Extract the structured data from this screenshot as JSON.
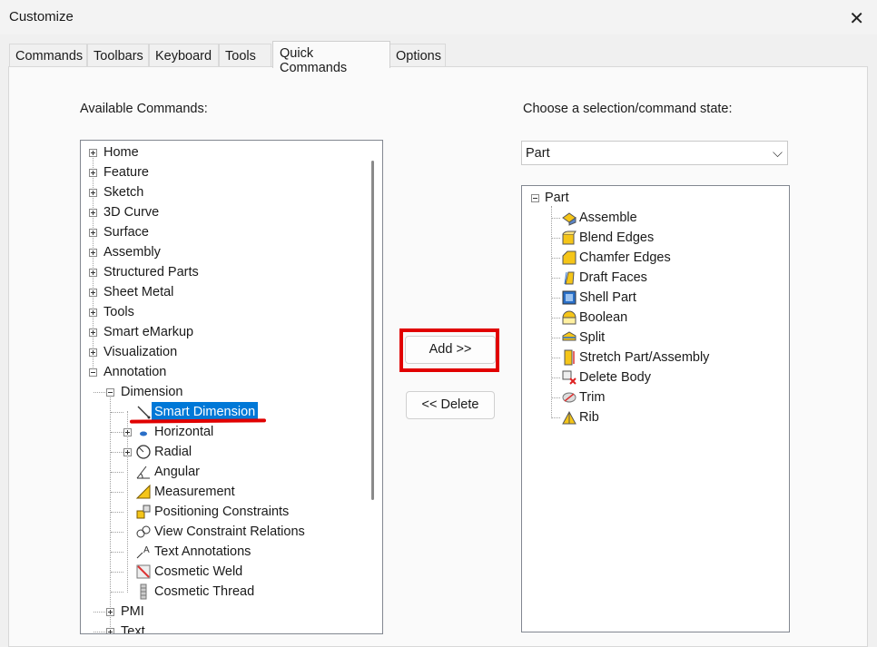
{
  "window": {
    "title": "Customize",
    "close_glyph": "✕"
  },
  "tabs": [
    {
      "label": "Commands",
      "active": false
    },
    {
      "label": "Toolbars",
      "active": false
    },
    {
      "label": "Keyboard",
      "active": false
    },
    {
      "label": "Tools",
      "active": false
    },
    {
      "label": "Quick Commands",
      "active": true
    },
    {
      "label": "Options",
      "active": false
    }
  ],
  "left": {
    "label": "Available Commands:",
    "tree": [
      {
        "label": "Home",
        "level": 0,
        "expander": "plus"
      },
      {
        "label": "Feature",
        "level": 0,
        "expander": "plus"
      },
      {
        "label": "Sketch",
        "level": 0,
        "expander": "plus"
      },
      {
        "label": "3D Curve",
        "level": 0,
        "expander": "plus"
      },
      {
        "label": "Surface",
        "level": 0,
        "expander": "plus"
      },
      {
        "label": "Assembly",
        "level": 0,
        "expander": "plus"
      },
      {
        "label": "Structured Parts",
        "level": 0,
        "expander": "plus"
      },
      {
        "label": "Sheet Metal",
        "level": 0,
        "expander": "plus"
      },
      {
        "label": "Tools",
        "level": 0,
        "expander": "plus"
      },
      {
        "label": "Smart eMarkup",
        "level": 0,
        "expander": "plus"
      },
      {
        "label": "Visualization",
        "level": 0,
        "expander": "plus"
      },
      {
        "label": "Annotation",
        "level": 0,
        "expander": "minus"
      },
      {
        "label": "Dimension",
        "level": 1,
        "expander": "minus"
      },
      {
        "label": "Smart Dimension",
        "level": 2,
        "icon": "smart-dimension-icon",
        "selected": true
      },
      {
        "label": "Horizontal",
        "level": 2,
        "expander": "plus",
        "icon": "horizontal-dimension-icon"
      },
      {
        "label": "Radial",
        "level": 2,
        "expander": "plus",
        "icon": "radial-dimension-icon"
      },
      {
        "label": "Angular",
        "level": 2,
        "icon": "angular-dimension-icon"
      },
      {
        "label": "Measurement",
        "level": 2,
        "icon": "measurement-icon"
      },
      {
        "label": "Positioning Constraints",
        "level": 2,
        "icon": "positioning-constraints-icon"
      },
      {
        "label": "View Constraint Relations",
        "level": 2,
        "icon": "view-constraint-relations-icon"
      },
      {
        "label": "Text Annotations",
        "level": 2,
        "icon": "text-annotations-icon"
      },
      {
        "label": "Cosmetic Weld",
        "level": 2,
        "icon": "cosmetic-weld-icon"
      },
      {
        "label": "Cosmetic Thread",
        "level": 2,
        "icon": "cosmetic-thread-icon"
      },
      {
        "label": "PMI",
        "level": 1,
        "expander": "plus"
      },
      {
        "label": "Text",
        "level": 1,
        "expander": "plus"
      }
    ]
  },
  "middle": {
    "add_label": "Add >>",
    "delete_label": "<< Delete"
  },
  "right": {
    "label": "Choose a selection/command state:",
    "combo_value": "Part",
    "combo_chevron": "⌵",
    "tree_root": "Part",
    "tree": [
      {
        "label": "Assemble",
        "icon": "assemble-icon"
      },
      {
        "label": "Blend Edges",
        "icon": "blend-edges-icon"
      },
      {
        "label": "Chamfer Edges",
        "icon": "chamfer-edges-icon"
      },
      {
        "label": "Draft Faces",
        "icon": "draft-faces-icon"
      },
      {
        "label": "Shell Part",
        "icon": "shell-part-icon"
      },
      {
        "label": "Boolean",
        "icon": "boolean-icon"
      },
      {
        "label": "Split",
        "icon": "split-icon"
      },
      {
        "label": "Stretch Part/Assembly",
        "icon": "stretch-part-assembly-icon"
      },
      {
        "label": "Delete Body",
        "icon": "delete-body-icon"
      },
      {
        "label": "Trim",
        "icon": "trim-icon"
      },
      {
        "label": "Rib",
        "icon": "rib-icon"
      }
    ]
  },
  "colors": {
    "selection": "#0078d7",
    "annotation_red": "#e10000",
    "icon_yellow": "#f5c518"
  }
}
